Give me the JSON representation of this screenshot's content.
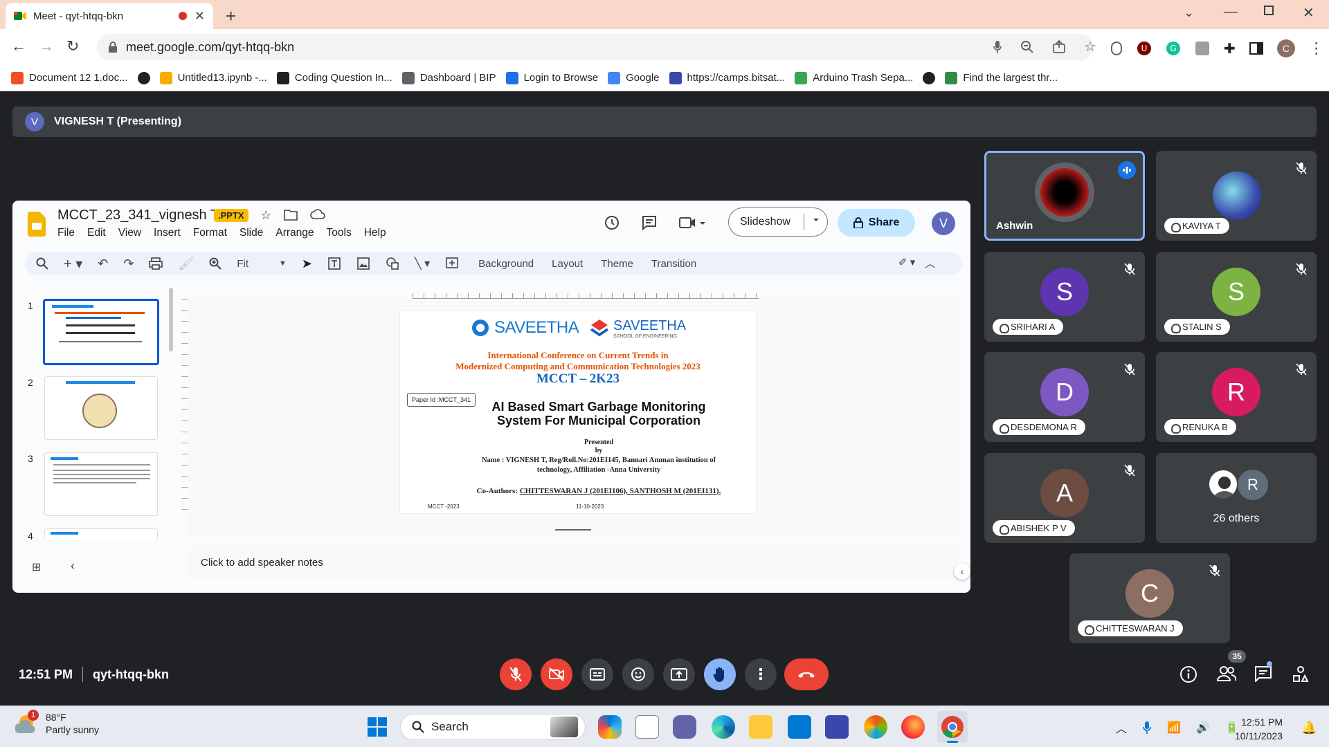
{
  "browser": {
    "tab_title": "Meet - qyt-htqq-bkn",
    "url": "meet.google.com/qyt-htqq-bkn",
    "profile_initial": "C",
    "bookmarks": [
      {
        "label": "Document 12 1.doc...",
        "color": "#f25022"
      },
      {
        "label": "",
        "color": "#202124"
      },
      {
        "label": "Untitled13.ipynb -...",
        "color": "#f9ab00"
      },
      {
        "label": "Coding Question In...",
        "color": "#202124"
      },
      {
        "label": "Dashboard | BIP",
        "color": "#5f6368"
      },
      {
        "label": "Login to Browse",
        "color": "#1a73e8"
      },
      {
        "label": "Google",
        "color": "#4285f4"
      },
      {
        "label": "https://camps.bitsat...",
        "color": "#3949ab"
      },
      {
        "label": "Arduino Trash Sepa...",
        "color": "#34a853"
      },
      {
        "label": "",
        "color": "#202124"
      },
      {
        "label": "Find the largest thr...",
        "color": "#2f8d46"
      }
    ]
  },
  "meet": {
    "presenter_initial": "V",
    "presenter_label": "VIGNESH T (Presenting)",
    "time": "12:51 PM",
    "meeting_code": "qyt-htqq-bkn",
    "people_count": "35",
    "participants": [
      {
        "name": "Ashwin",
        "initial": "",
        "color": "#8b0000",
        "speaking": true
      },
      {
        "name": "KAVIYA T",
        "initial": "",
        "color": "#3a6ea5"
      },
      {
        "name": "SRIHARI A",
        "initial": "S",
        "color": "#5e35b1"
      },
      {
        "name": "STALIN S",
        "initial": "S",
        "color": "#7cb342"
      },
      {
        "name": "DESDEMONA R",
        "initial": "D",
        "color": "#7e57c2"
      },
      {
        "name": "RENUKA B",
        "initial": "R",
        "color": "#d81b60"
      },
      {
        "name": "ABISHEK P V",
        "initial": "A",
        "color": "#6d4c41"
      },
      {
        "name": "CHITTESWARAN J",
        "initial": "C",
        "color": "#8d6e63"
      }
    ],
    "others_label": "26 others",
    "others_initial": "R"
  },
  "slides": {
    "doc_name": "MCCT_23_341_vignesh T",
    "badge": ".PPTX",
    "menu": [
      "File",
      "Edit",
      "View",
      "Insert",
      "Format",
      "Slide",
      "Arrange",
      "Tools",
      "Help"
    ],
    "zoom": "Fit",
    "toolbar_buttons": [
      "Background",
      "Layout",
      "Theme",
      "Transition"
    ],
    "slideshow_label": "Slideshow",
    "share_label": "Share",
    "user_initial": "V",
    "thumb_numbers": [
      "1",
      "2",
      "3",
      "4"
    ],
    "notes_placeholder": "Click to add speaker notes",
    "slide": {
      "logo1": "SAVEETHA",
      "logo2": "SAVEETHA",
      "logo2_sub": "SCHOOL OF ENGINEERING",
      "conf_line1": "International Conference on Current Trends in",
      "conf_line2": "Modernized Computing and Communication Technologies 2023",
      "conf_code": "MCCT – 2K23",
      "paper_id": "Paper Id :MCCT_341",
      "title1": "AI Based Smart Garbage Monitoring",
      "title2": "System For Municipal Corporation",
      "presented": "Presented",
      "by": "by",
      "name_line1": "Name : VIGNESH T, Reg/Roll.No:201EI145, Bannari Amman institution of",
      "name_line2": "technology, Affiliation -Anna University",
      "coauthors_label": "Co-Authors:",
      "coauthors": "CHITTESWARAN J (201EI106),  SANTHOSH M (201EI131).",
      "footer_left": "MCCT -2023",
      "footer_date": "11-10-2023"
    }
  },
  "taskbar": {
    "temp": "88°F",
    "weather": "Partly sunny",
    "weather_badge": "1",
    "search_label": "Search",
    "clock_time": "12:51 PM",
    "clock_date": "10/11/2023"
  }
}
